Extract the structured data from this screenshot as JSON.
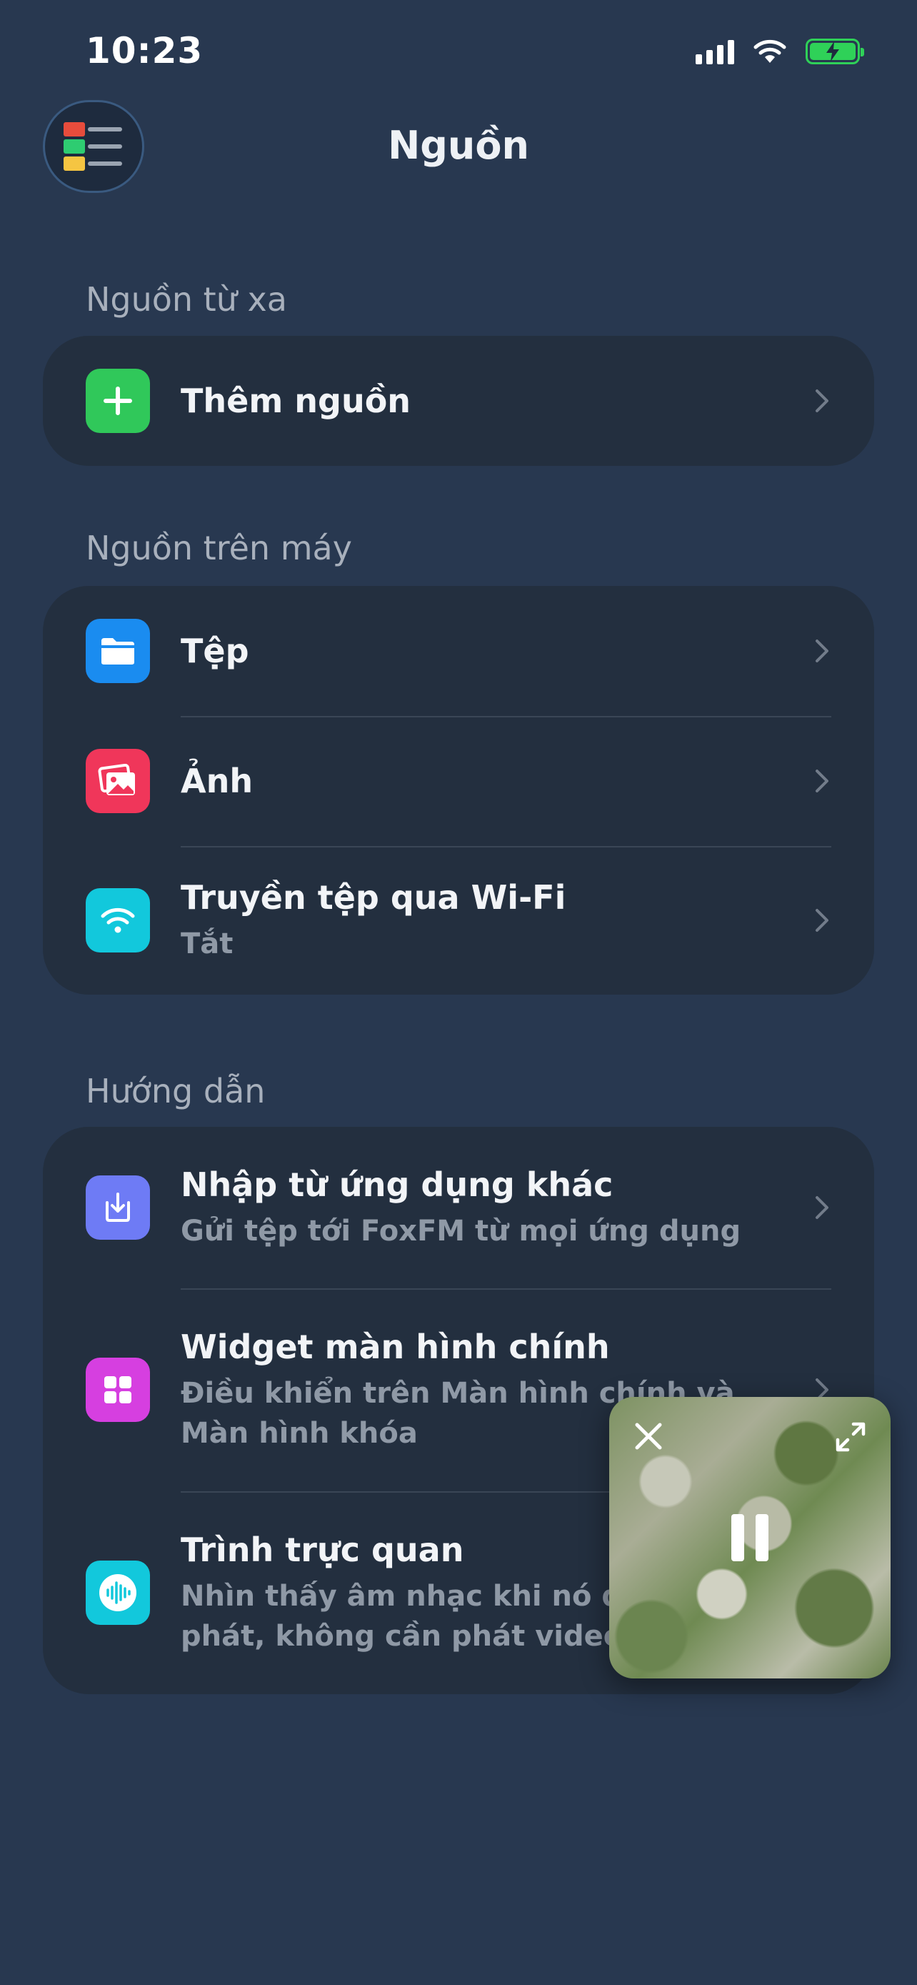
{
  "status_bar": {
    "time": "10:23",
    "icons": [
      "cellular-signal-icon",
      "wifi-icon",
      "battery-charging-icon"
    ]
  },
  "header": {
    "menu_icon": "sources-menu-icon",
    "title": "Nguồn"
  },
  "sections": {
    "remote": {
      "label": "Nguồn từ xa",
      "items": [
        {
          "title": "Thêm nguồn",
          "icon": "plus-icon",
          "icon_color": "#30c85a"
        }
      ]
    },
    "local": {
      "label": "Nguồn trên máy",
      "items": [
        {
          "title": "Tệp",
          "icon": "folder-icon",
          "icon_color": "#1a8cf0"
        },
        {
          "title": "Ảnh",
          "icon": "photos-icon",
          "icon_color": "#f0365a"
        },
        {
          "title": "Truyền tệp qua Wi-Fi",
          "subtitle": "Tắt",
          "icon": "wifi-icon",
          "icon_color": "#12c8dc"
        }
      ]
    },
    "guides": {
      "label": "Hướng dẫn",
      "items": [
        {
          "title": "Nhập từ ứng dụng khác",
          "subtitle": "Gửi tệp tới FoxFM từ mọi ứng dụng",
          "icon": "import-icon",
          "icon_color": "#6e7bf5"
        },
        {
          "title": "Widget màn hình chính",
          "subtitle": "Điều khiển trên Màn hình chính và Màn hình khóa",
          "icon": "widget-grid-icon",
          "icon_color": "#d63fe0"
        },
        {
          "title": "Trình trực quan",
          "subtitle": "Nhìn thấy âm nhạc khi nó đang phát, không cần phát video",
          "icon": "waveform-icon",
          "icon_color": "#12c8dc"
        }
      ]
    }
  },
  "pip": {
    "close_icon": "close-icon",
    "expand_icon": "expand-icon",
    "pause_icon": "pause-icon"
  }
}
